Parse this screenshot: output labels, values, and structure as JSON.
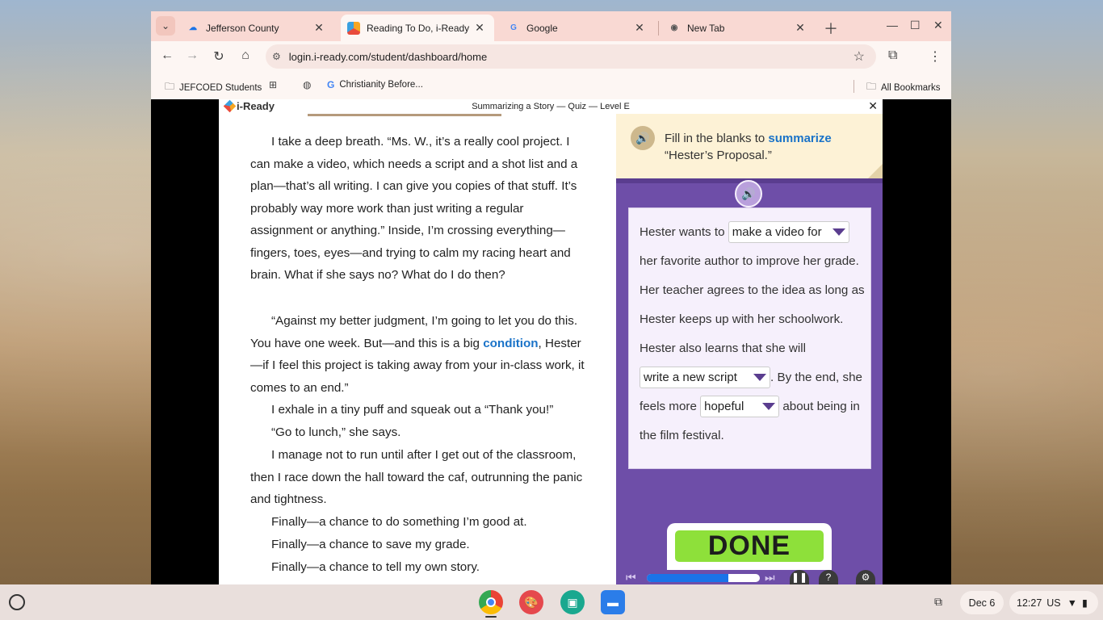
{
  "browser": {
    "tabs": [
      {
        "title": "Jefferson County",
        "icon": "cloud-icon",
        "active": false
      },
      {
        "title": "Reading To Do, i-Ready",
        "icon": "iready-icon",
        "active": true
      },
      {
        "title": "Google",
        "icon": "google-icon",
        "active": false
      },
      {
        "title": "New Tab",
        "icon": "chrome-icon",
        "active": false
      }
    ],
    "url": "login.i-ready.com/student/dashboard/home",
    "bookmarks": [
      {
        "label": "JEFCOED Students",
        "icon": "folder-icon"
      },
      {
        "label": "",
        "icon": "apps-grid-icon"
      },
      {
        "label": "",
        "icon": "globe-icon"
      },
      {
        "label": "Christianity Before...",
        "icon": "google-icon"
      }
    ],
    "all_bookmarks": "All Bookmarks"
  },
  "app": {
    "logo": "i-Ready",
    "title": "Summarizing a Story — Quiz — Level E",
    "close": "✕"
  },
  "reading": {
    "p1": "I take a deep breath. “Ms. W., it’s a really cool project. I can make a video, which needs a script and a shot list and a plan—that’s all writing. I can give you copies of that stuff. It’s probably way more work than just writing a regular assignment or anything.” Inside, I’m crossing everything—fingers, toes, eyes—and trying to calm my racing heart and brain. What if she says no? What do I do then?",
    "p2_before": "“Against my better judgment, I’m going to let you do this. You have one week. But—and this is a big ",
    "p2_vocab": "condition",
    "p2_after": ", Hester—if I feel this project is taking away from your in-class work, it comes to an end.”",
    "p3": "I exhale in a tiny puff and squeak out a “Thank you!”",
    "p4": "“Go to lunch,” she says.",
    "p5": "I manage not to run until after I get out of the classroom, then I race down the hall toward the caf, outrunning the panic and tightness.",
    "p6": "Finally—a chance to do something I’m good at.",
    "p7": "Finally—a chance to save my grade.",
    "p8": "Finally—a chance to tell my own story."
  },
  "panel": {
    "prompt_before": "Fill in the blanks to ",
    "prompt_keyword": "summarize",
    "prompt_after": "“Hester’s Proposal.”",
    "s1": "Hester wants to ",
    "dd1": "make a video for",
    "s2": " her favorite author to improve her grade. Her teacher agrees to the idea as long as Hester keeps up with her schoolwork. Hester also learns that she will ",
    "dd2": "write a new script",
    "s3": ". By the end, she feels more ",
    "dd3": "hopeful",
    "s4": " about being in the film festival.",
    "done": "DONE",
    "progress": 0.72
  },
  "shelf": {
    "date": "Dec 6",
    "time": "12:27",
    "locale": "US"
  },
  "colors": {
    "accent_blue": "#1a73c8",
    "panel_purple": "#6e4ea8",
    "done_green": "#8ee03a"
  }
}
